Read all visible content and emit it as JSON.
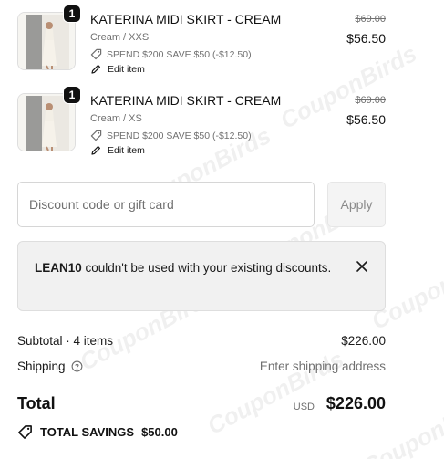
{
  "cart_items": [
    {
      "name": "KATERINA MIDI SKIRT - CREAM",
      "variant": "Cream / XXS",
      "quantity": "1",
      "discount": "SPEND $200 SAVE $50 (-$12.50)",
      "edit_label": "Edit item",
      "original_price": "$69.00",
      "price": "$56.50"
    },
    {
      "name": "KATERINA MIDI SKIRT - CREAM",
      "variant": "Cream / XS",
      "quantity": "1",
      "discount": "SPEND $200 SAVE $50 (-$12.50)",
      "edit_label": "Edit item",
      "original_price": "$69.00",
      "price": "$56.50"
    }
  ],
  "discount": {
    "placeholder": "Discount code or gift card",
    "apply_label": "Apply"
  },
  "alert": {
    "code": "LEAN10",
    "message": " couldn't be used with your existing discounts."
  },
  "summary": {
    "subtotal_label": "Subtotal · 4 items",
    "subtotal_value": "$226.00",
    "shipping_label": "Shipping",
    "shipping_value": "Enter shipping address",
    "total_label": "Total",
    "currency": "USD",
    "total_value": "$226.00",
    "savings_label": "TOTAL SAVINGS",
    "savings_value": "$50.00"
  },
  "watermark": "CouponBirds",
  "colors": {
    "text": "#1a1a1a",
    "muted": "#707070",
    "alert_bg": "#f1f1f1",
    "badge": "#111111"
  }
}
